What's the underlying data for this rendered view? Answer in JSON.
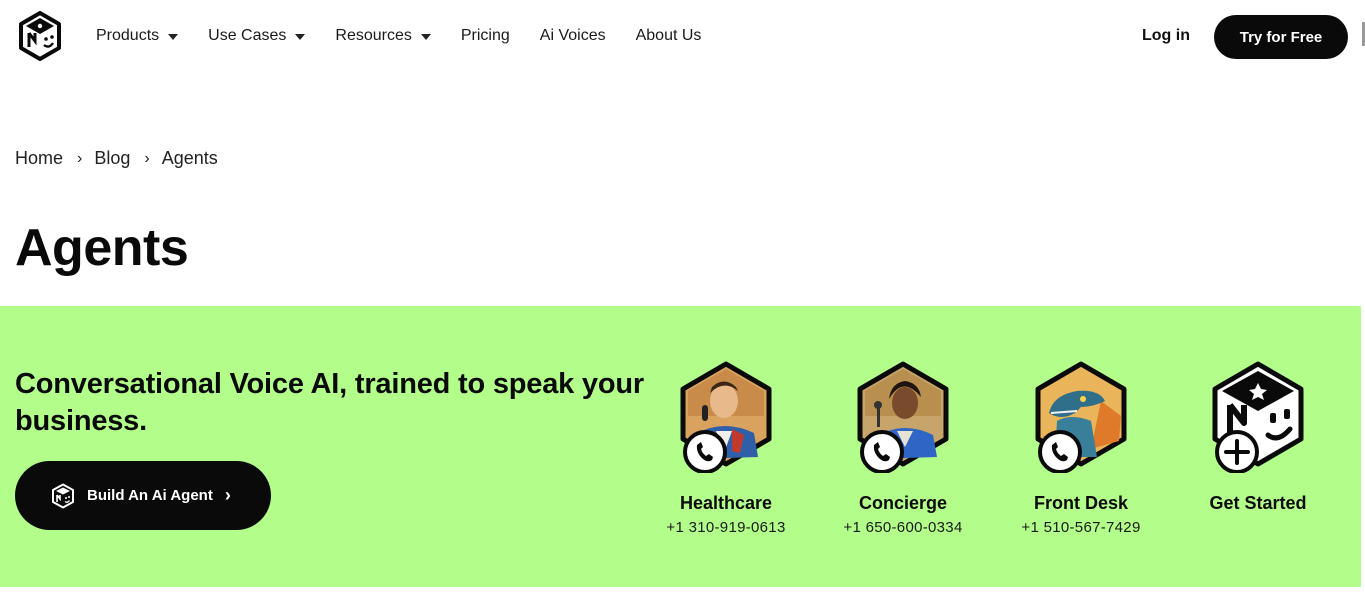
{
  "nav": {
    "menu": [
      {
        "label": "Products",
        "dropdown": true
      },
      {
        "label": "Use Cases",
        "dropdown": true
      },
      {
        "label": "Resources",
        "dropdown": true
      },
      {
        "label": "Pricing",
        "dropdown": false
      },
      {
        "label": "Ai Voices",
        "dropdown": false
      },
      {
        "label": "About Us",
        "dropdown": false
      }
    ],
    "login_label": "Log in",
    "cta_label": "Try for Free"
  },
  "breadcrumb": {
    "items": [
      "Home",
      "Blog",
      "Agents"
    ],
    "separator": "›"
  },
  "page": {
    "title": "Agents"
  },
  "banner": {
    "background": "#b3fd8a",
    "headline": "Conversational Voice AI, trained to speak your business.",
    "build_button_label": "Build An Ai Agent",
    "build_button_chevron": "›",
    "agents": [
      {
        "name": "Healthcare",
        "phone": "+1 310-919-0613",
        "icon": "phone-icon"
      },
      {
        "name": "Concierge",
        "phone": "+1 650-600-0334",
        "icon": "phone-icon"
      },
      {
        "name": "Front Desk",
        "phone": "+1 510-567-7429",
        "icon": "phone-icon"
      },
      {
        "name": "Get Started",
        "phone": "",
        "icon": "plus-icon"
      }
    ]
  }
}
